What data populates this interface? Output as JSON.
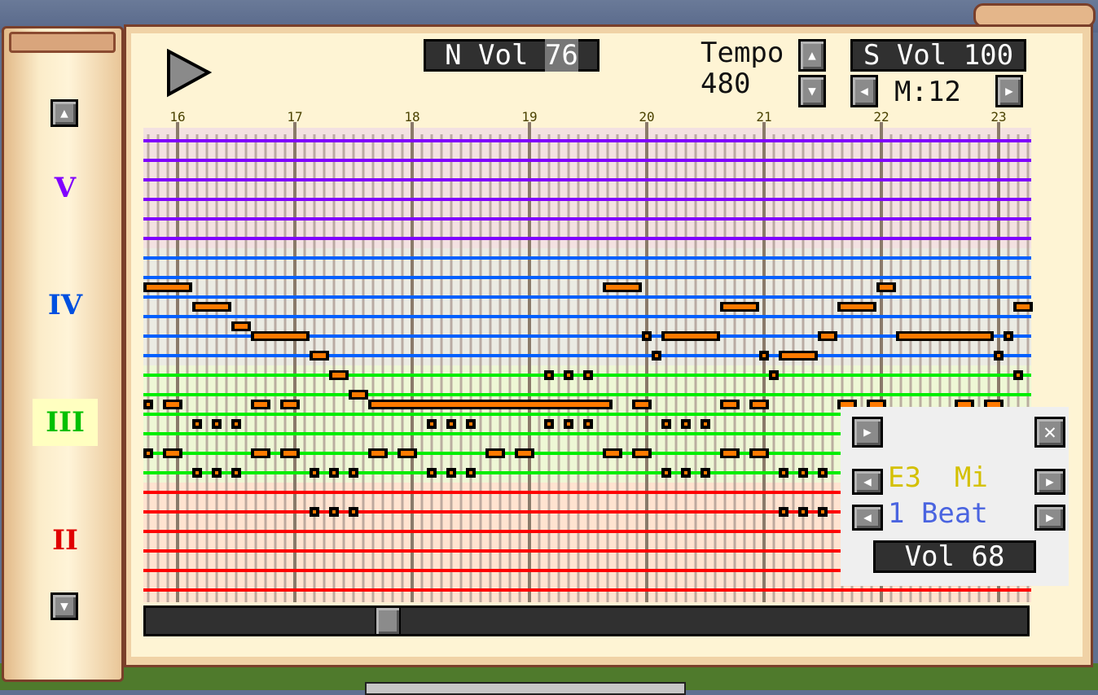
{
  "header": {
    "play_icon": "play-triangle-icon",
    "note_volume_label": "N Vol ",
    "note_volume_value": "76",
    "tempo_label": "Tempo",
    "tempo_value": "480",
    "song_volume_label": "S Vol ",
    "song_volume_value": "100",
    "measure_label": "M:12"
  },
  "sidebar": {
    "up_icon": "arrow-up-icon",
    "down_icon": "arrow-down-icon",
    "octaves": [
      {
        "label": "V",
        "color": "#8000ff",
        "selected": false
      },
      {
        "label": "IV",
        "color": "#0050e0",
        "selected": false
      },
      {
        "label": "III",
        "color": "#00c000",
        "selected": true
      },
      {
        "label": "II",
        "color": "#e00000",
        "selected": false
      }
    ]
  },
  "sheet": {
    "measure_labels": [
      "16",
      "17",
      "18",
      "19",
      "20",
      "21",
      "22",
      "23"
    ],
    "staff_colors": [
      "#8000ff",
      "#0060ff",
      "#00ee00",
      "#ff0000"
    ],
    "band_colors": [
      "#f3e1e1",
      "#ebebe3",
      "#eef7d5",
      "#ffe3d0"
    ],
    "note_color": "#ff7a00",
    "notes": [
      {
        "row": 15,
        "start": 0,
        "end": 4
      },
      {
        "row": 15,
        "start": 47,
        "end": 50
      },
      {
        "row": 15,
        "start": 75,
        "end": 76
      },
      {
        "row": 17,
        "start": 5,
        "end": 8
      },
      {
        "row": 17,
        "start": 59,
        "end": 62
      },
      {
        "row": 17,
        "start": 71,
        "end": 74
      },
      {
        "row": 17,
        "start": 89,
        "end": 90
      },
      {
        "row": 19,
        "start": 9,
        "end": 10
      },
      {
        "row": 20,
        "start": 11,
        "end": 16
      },
      {
        "row": 20,
        "start": 51,
        "end": 51
      },
      {
        "row": 20,
        "start": 53,
        "end": 58
      },
      {
        "row": 20,
        "start": 69,
        "end": 70
      },
      {
        "row": 20,
        "start": 77,
        "end": 86
      },
      {
        "row": 20,
        "start": 88,
        "end": 88
      },
      {
        "row": 22,
        "start": 17,
        "end": 18
      },
      {
        "row": 22,
        "start": 52,
        "end": 52
      },
      {
        "row": 22,
        "start": 63,
        "end": 63
      },
      {
        "row": 22,
        "start": 65,
        "end": 68
      },
      {
        "row": 22,
        "start": 87,
        "end": 87
      },
      {
        "row": 24,
        "start": 19,
        "end": 20
      },
      {
        "row": 24,
        "start": 41,
        "end": 41
      },
      {
        "row": 24,
        "start": 43,
        "end": 43
      },
      {
        "row": 24,
        "start": 45,
        "end": 45
      },
      {
        "row": 24,
        "start": 64,
        "end": 64
      },
      {
        "row": 24,
        "start": 89,
        "end": 89
      },
      {
        "row": 26,
        "start": 21,
        "end": 22
      },
      {
        "row": 27,
        "start": 0,
        "end": 0
      },
      {
        "row": 27,
        "start": 2,
        "end": 3
      },
      {
        "row": 27,
        "start": 11,
        "end": 12
      },
      {
        "row": 27,
        "start": 14,
        "end": 15
      },
      {
        "row": 27,
        "start": 23,
        "end": 47
      },
      {
        "row": 27,
        "start": 50,
        "end": 51
      },
      {
        "row": 27,
        "start": 59,
        "end": 60
      },
      {
        "row": 27,
        "start": 62,
        "end": 63
      },
      {
        "row": 27,
        "start": 71,
        "end": 72
      },
      {
        "row": 27,
        "start": 74,
        "end": 75
      },
      {
        "row": 27,
        "start": 83,
        "end": 84
      },
      {
        "row": 27,
        "start": 86,
        "end": 87
      },
      {
        "row": 29,
        "start": 5,
        "end": 5
      },
      {
        "row": 29,
        "start": 7,
        "end": 7
      },
      {
        "row": 29,
        "start": 9,
        "end": 9
      },
      {
        "row": 29,
        "start": 29,
        "end": 29
      },
      {
        "row": 29,
        "start": 31,
        "end": 31
      },
      {
        "row": 29,
        "start": 33,
        "end": 33
      },
      {
        "row": 29,
        "start": 41,
        "end": 41
      },
      {
        "row": 29,
        "start": 43,
        "end": 43
      },
      {
        "row": 29,
        "start": 45,
        "end": 45
      },
      {
        "row": 29,
        "start": 53,
        "end": 53
      },
      {
        "row": 29,
        "start": 55,
        "end": 55
      },
      {
        "row": 29,
        "start": 57,
        "end": 57
      },
      {
        "row": 32,
        "start": 0,
        "end": 0
      },
      {
        "row": 32,
        "start": 2,
        "end": 3
      },
      {
        "row": 32,
        "start": 11,
        "end": 12
      },
      {
        "row": 32,
        "start": 14,
        "end": 15
      },
      {
        "row": 32,
        "start": 23,
        "end": 24
      },
      {
        "row": 32,
        "start": 26,
        "end": 27
      },
      {
        "row": 32,
        "start": 35,
        "end": 36
      },
      {
        "row": 32,
        "start": 38,
        "end": 39
      },
      {
        "row": 32,
        "start": 47,
        "end": 48
      },
      {
        "row": 32,
        "start": 50,
        "end": 51
      },
      {
        "row": 32,
        "start": 59,
        "end": 60
      },
      {
        "row": 32,
        "start": 62,
        "end": 63
      },
      {
        "row": 34,
        "start": 5,
        "end": 5
      },
      {
        "row": 34,
        "start": 7,
        "end": 7
      },
      {
        "row": 34,
        "start": 9,
        "end": 9
      },
      {
        "row": 34,
        "start": 17,
        "end": 17
      },
      {
        "row": 34,
        "start": 19,
        "end": 19
      },
      {
        "row": 34,
        "start": 21,
        "end": 21
      },
      {
        "row": 34,
        "start": 29,
        "end": 29
      },
      {
        "row": 34,
        "start": 31,
        "end": 31
      },
      {
        "row": 34,
        "start": 33,
        "end": 33
      },
      {
        "row": 34,
        "start": 53,
        "end": 53
      },
      {
        "row": 34,
        "start": 55,
        "end": 55
      },
      {
        "row": 34,
        "start": 57,
        "end": 57
      },
      {
        "row": 34,
        "start": 65,
        "end": 65
      },
      {
        "row": 34,
        "start": 67,
        "end": 67
      },
      {
        "row": 34,
        "start": 69,
        "end": 69
      },
      {
        "row": 38,
        "start": 17,
        "end": 17
      },
      {
        "row": 38,
        "start": 19,
        "end": 19
      },
      {
        "row": 38,
        "start": 21,
        "end": 21
      },
      {
        "row": 38,
        "start": 65,
        "end": 65
      },
      {
        "row": 38,
        "start": 67,
        "end": 67
      },
      {
        "row": 38,
        "start": 69,
        "end": 69
      }
    ],
    "scroll_position": 0.26
  },
  "note_panel": {
    "play_icon": "play-small-icon",
    "close_icon": "close-x-icon",
    "pitch_label": "E3  Mi",
    "pitch_color": "#d4c000",
    "duration_label": "1 Beat",
    "duration_color": "#4a64e0",
    "volume_label": "Vol ",
    "volume_value": "68"
  }
}
